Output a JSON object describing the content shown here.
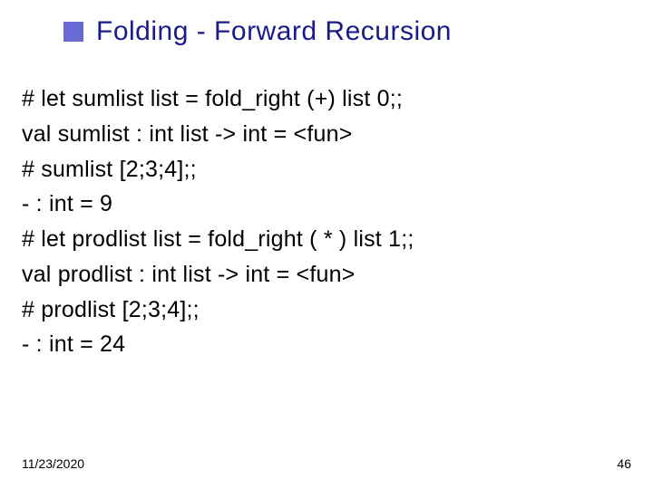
{
  "title": "Folding - Forward Recursion",
  "lines": [
    "# let sumlist list = fold_right (+) list 0;;",
    "val sumlist : int list -> int = <fun>",
    "# sumlist [2;3;4];;",
    "- : int = 9",
    "# let prodlist list = fold_right ( * ) list 1;;",
    "val prodlist : int list -> int = <fun>",
    "# prodlist [2;3;4];;",
    "- : int = 24"
  ],
  "footer": {
    "date": "11/23/2020",
    "page": "46"
  }
}
